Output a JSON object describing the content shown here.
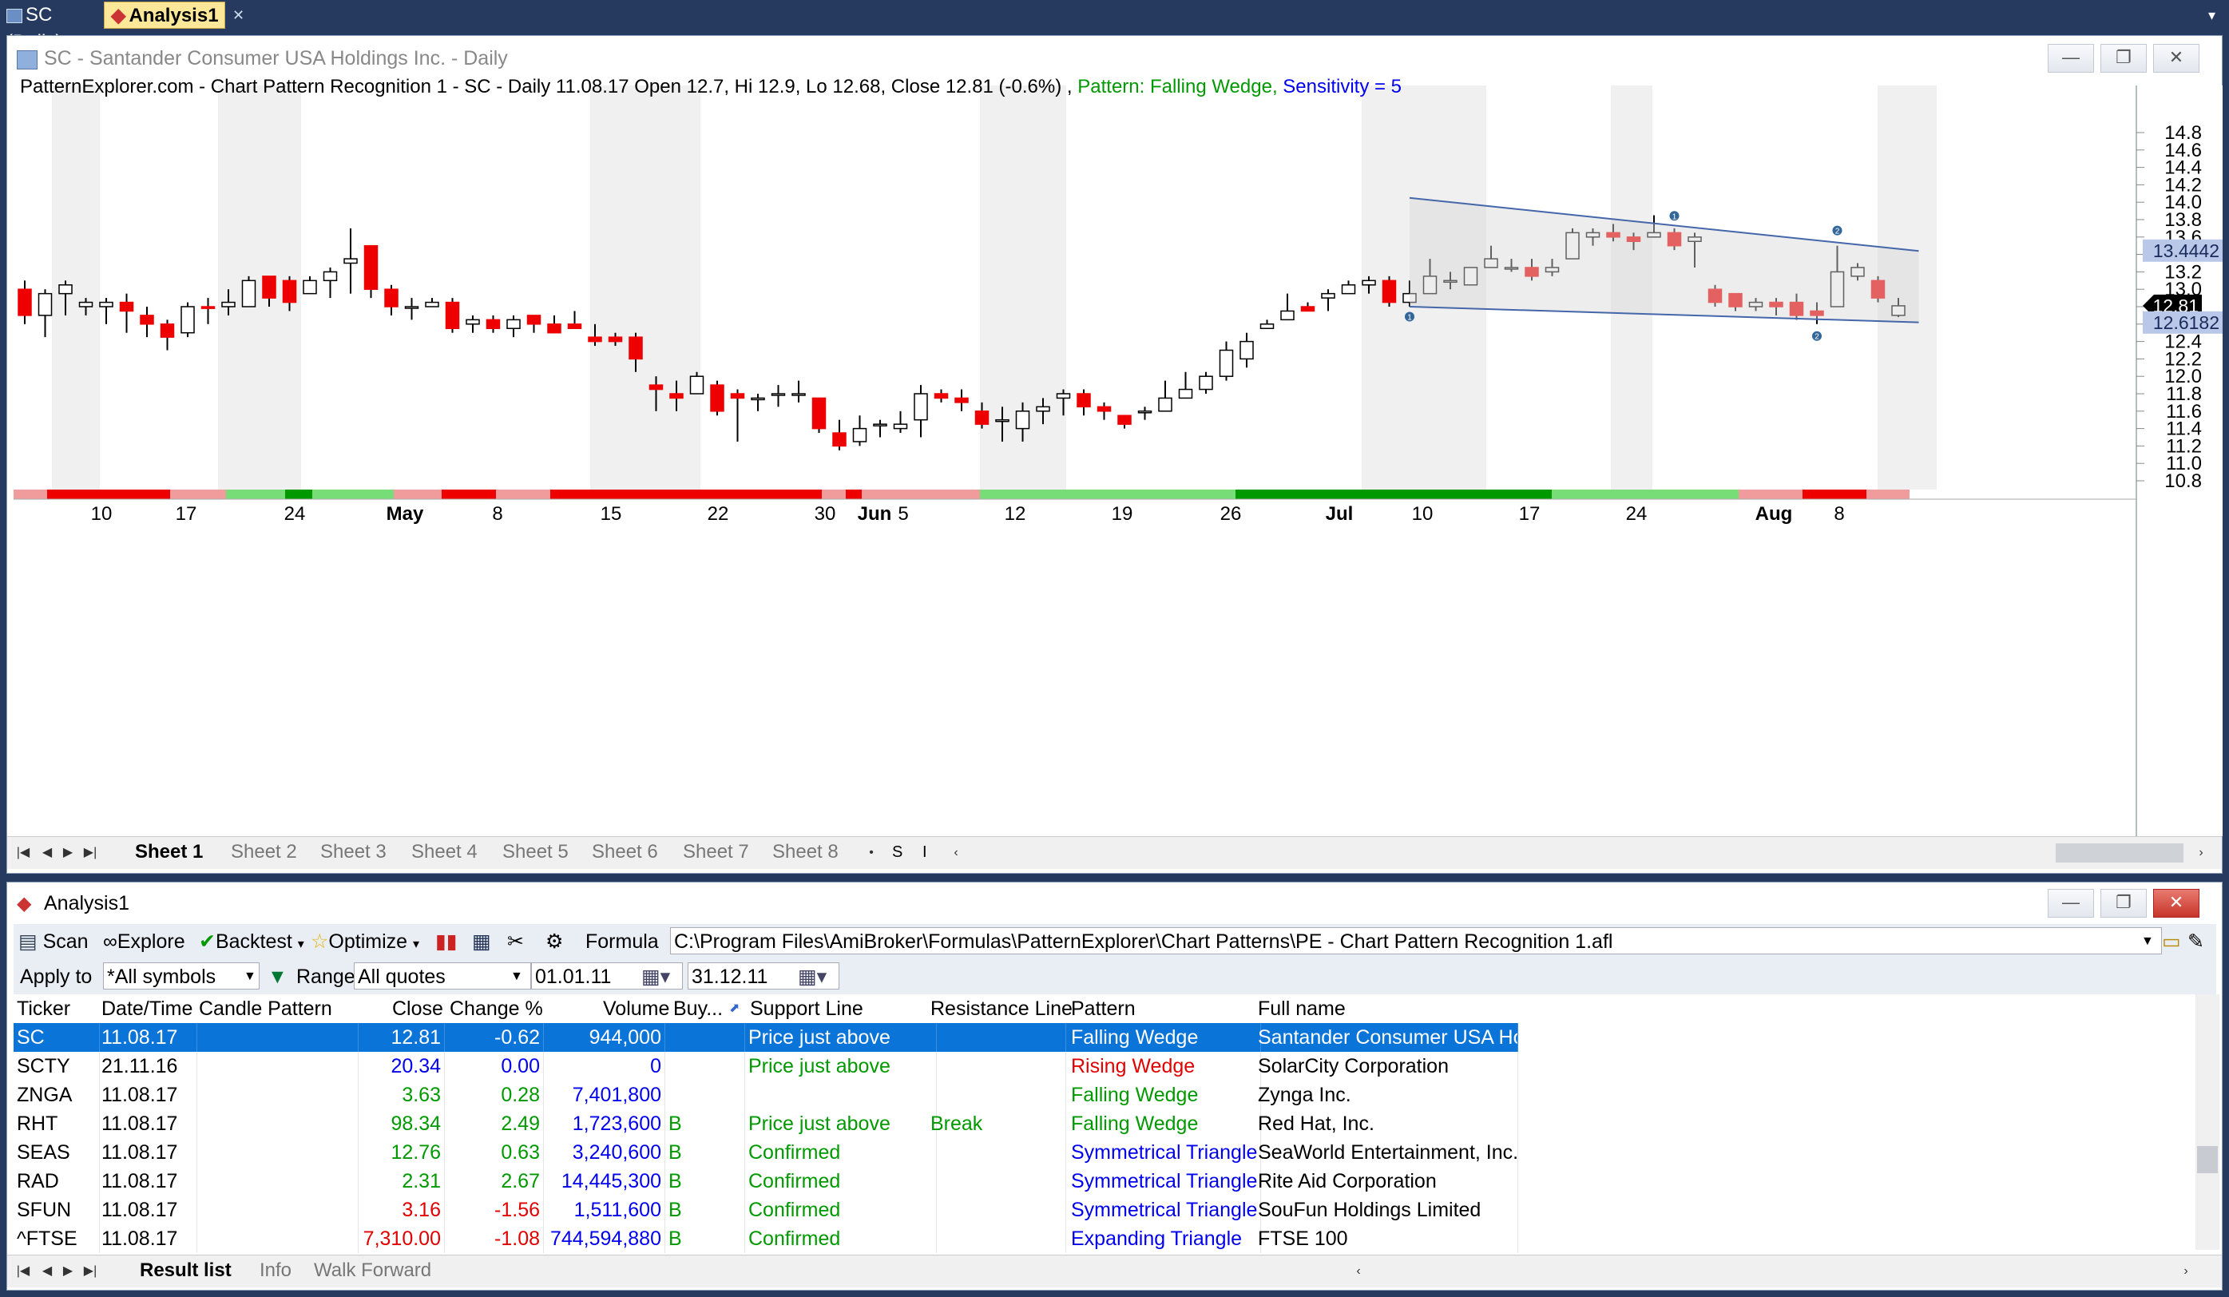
{
  "doc_tabs": [
    {
      "label": "SC (Daily)",
      "active": false
    },
    {
      "label": "Analysis1",
      "active": true
    }
  ],
  "chart_window": {
    "title": "SC - Santander Consumer USA Holdings Inc. - Daily",
    "header_main": "PatternExplorer.com - Chart Pattern Recognition 1 - SC - Daily 11.08.17 Open 12.7, Hi 12.9, Lo 12.68, Close 12.81 (-0.6%) ,",
    "header_pattern": "Pattern: Falling Wedge,",
    "header_sensitivity": "Sensitivity = 5",
    "price_labels": {
      "upper": "13.4442",
      "last": "12.81",
      "lower": "12.6182"
    },
    "pattern_markers": [
      "1",
      "1",
      "2",
      "2"
    ],
    "sheet_tabs": [
      "Sheet 1",
      "Sheet 2",
      "Sheet 3",
      "Sheet 4",
      "Sheet 5",
      "Sheet 6",
      "Sheet 7",
      "Sheet 8"
    ],
    "sheet_extra": [
      "S",
      "I"
    ]
  },
  "chart_data": {
    "type": "candlestick",
    "y_ticks": [
      "14.8",
      "14.6",
      "14.4",
      "14.2",
      "14.0",
      "13.8",
      "13.6",
      "13.4",
      "13.2",
      "13.0",
      "12.8",
      "12.6",
      "12.4",
      "12.2",
      "12.0",
      "11.8",
      "11.6",
      "11.4",
      "11.2",
      "11.0",
      "10.8"
    ],
    "x_ticks": [
      "10",
      "17",
      "24",
      "May",
      "8",
      "15",
      "22",
      "30",
      "Jun",
      "5",
      "12",
      "19",
      "26",
      "Jul",
      "10",
      "17",
      "24",
      "Aug",
      "8"
    ],
    "ylim": [
      10.7,
      14.9
    ],
    "candles": [
      [
        13.0,
        12.7,
        13.1,
        12.6
      ],
      [
        12.7,
        12.95,
        13.0,
        12.45
      ],
      [
        12.95,
        13.05,
        13.1,
        12.7
      ],
      [
        12.8,
        12.85,
        12.9,
        12.7
      ],
      [
        12.8,
        12.85,
        12.9,
        12.6
      ],
      [
        12.85,
        12.75,
        12.95,
        12.5
      ],
      [
        12.7,
        12.6,
        12.8,
        12.45
      ],
      [
        12.6,
        12.45,
        12.65,
        12.3
      ],
      [
        12.5,
        12.8,
        12.85,
        12.45
      ],
      [
        12.8,
        12.78,
        12.9,
        12.6
      ],
      [
        12.8,
        12.85,
        13.0,
        12.7
      ],
      [
        12.8,
        13.1,
        13.15,
        12.8
      ],
      [
        13.15,
        12.9,
        13.15,
        12.8
      ],
      [
        13.1,
        12.85,
        13.15,
        12.75
      ],
      [
        12.95,
        13.1,
        13.15,
        12.95
      ],
      [
        13.1,
        13.2,
        13.25,
        12.9
      ],
      [
        13.3,
        13.35,
        13.7,
        12.95
      ],
      [
        13.5,
        13.0,
        13.5,
        12.9
      ],
      [
        13.0,
        12.8,
        13.05,
        12.7
      ],
      [
        12.8,
        12.8,
        12.9,
        12.65
      ],
      [
        12.8,
        12.85,
        12.9,
        12.8
      ],
      [
        12.85,
        12.55,
        12.9,
        12.5
      ],
      [
        12.6,
        12.65,
        12.7,
        12.5
      ],
      [
        12.65,
        12.55,
        12.7,
        12.5
      ],
      [
        12.55,
        12.65,
        12.7,
        12.45
      ],
      [
        12.7,
        12.6,
        12.7,
        12.5
      ],
      [
        12.6,
        12.5,
        12.7,
        12.5
      ],
      [
        12.6,
        12.55,
        12.75,
        12.55
      ],
      [
        12.45,
        12.4,
        12.6,
        12.35
      ],
      [
        12.45,
        12.4,
        12.5,
        12.35
      ],
      [
        12.45,
        12.2,
        12.5,
        12.05
      ],
      [
        11.9,
        11.85,
        12.0,
        11.6
      ],
      [
        11.8,
        11.75,
        11.95,
        11.6
      ],
      [
        11.8,
        12.0,
        12.05,
        11.8
      ],
      [
        11.9,
        11.6,
        11.95,
        11.55
      ],
      [
        11.8,
        11.75,
        11.85,
        11.25
      ],
      [
        11.75,
        11.75,
        11.8,
        11.6
      ],
      [
        11.8,
        11.8,
        11.9,
        11.65
      ],
      [
        11.8,
        11.8,
        11.95,
        11.7
      ],
      [
        11.75,
        11.4,
        11.75,
        11.35
      ],
      [
        11.35,
        11.2,
        11.5,
        11.15
      ],
      [
        11.25,
        11.4,
        11.55,
        11.2
      ],
      [
        11.45,
        11.45,
        11.5,
        11.3
      ],
      [
        11.4,
        11.45,
        11.6,
        11.35
      ],
      [
        11.5,
        11.8,
        11.9,
        11.3
      ],
      [
        11.8,
        11.75,
        11.85,
        11.7
      ],
      [
        11.75,
        11.7,
        11.85,
        11.6
      ],
      [
        11.6,
        11.45,
        11.7,
        11.4
      ],
      [
        11.5,
        11.5,
        11.65,
        11.25
      ],
      [
        11.4,
        11.6,
        11.7,
        11.25
      ],
      [
        11.6,
        11.65,
        11.75,
        11.45
      ],
      [
        11.75,
        11.8,
        11.85,
        11.55
      ],
      [
        11.8,
        11.65,
        11.85,
        11.55
      ],
      [
        11.65,
        11.6,
        11.7,
        11.5
      ],
      [
        11.55,
        11.45,
        11.55,
        11.4
      ],
      [
        11.6,
        11.6,
        11.65,
        11.5
      ],
      [
        11.6,
        11.75,
        11.95,
        11.6
      ],
      [
        11.75,
        11.85,
        12.05,
        11.75
      ],
      [
        11.85,
        12.0,
        12.05,
        11.8
      ],
      [
        12.0,
        12.3,
        12.4,
        11.95
      ],
      [
        12.2,
        12.4,
        12.5,
        12.1
      ],
      [
        12.55,
        12.6,
        12.65,
        12.55
      ],
      [
        12.65,
        12.75,
        12.95,
        12.65
      ],
      [
        12.8,
        12.75,
        12.85,
        12.75
      ],
      [
        12.9,
        12.95,
        13.0,
        12.75
      ],
      [
        12.95,
        13.05,
        13.1,
        12.95
      ],
      [
        13.05,
        13.1,
        13.15,
        12.95
      ],
      [
        13.1,
        12.85,
        13.15,
        12.8
      ],
      [
        12.85,
        12.95,
        13.1,
        12.8
      ],
      [
        12.95,
        13.15,
        13.35,
        13.0
      ],
      [
        13.1,
        13.1,
        13.2,
        13.0
      ],
      [
        13.05,
        13.25,
        13.25,
        13.05
      ],
      [
        13.25,
        13.35,
        13.5,
        13.25
      ],
      [
        13.25,
        13.25,
        13.35,
        13.2
      ],
      [
        13.25,
        13.15,
        13.35,
        13.1
      ],
      [
        13.2,
        13.25,
        13.35,
        13.15
      ],
      [
        13.35,
        13.65,
        13.7,
        13.35
      ],
      [
        13.6,
        13.65,
        13.7,
        13.5
      ],
      [
        13.65,
        13.6,
        13.75,
        13.55
      ],
      [
        13.6,
        13.55,
        13.65,
        13.45
      ],
      [
        13.6,
        13.65,
        13.85,
        13.6
      ],
      [
        13.65,
        13.5,
        13.7,
        13.45
      ],
      [
        13.55,
        13.6,
        13.65,
        13.25
      ],
      [
        13.0,
        12.85,
        13.05,
        12.8
      ],
      [
        12.95,
        12.8,
        12.95,
        12.75
      ],
      [
        12.8,
        12.85,
        12.9,
        12.75
      ],
      [
        12.85,
        12.8,
        12.9,
        12.7
      ],
      [
        12.85,
        12.7,
        12.95,
        12.65
      ],
      [
        12.75,
        12.7,
        12.85,
        12.6
      ],
      [
        12.8,
        13.2,
        13.5,
        13.0
      ],
      [
        13.15,
        13.25,
        13.3,
        13.1
      ],
      [
        13.1,
        12.9,
        13.15,
        12.85
      ],
      [
        12.7,
        12.81,
        12.9,
        12.68
      ]
    ]
  },
  "analysis_window": {
    "title": "Analysis1",
    "toolbar": {
      "scan": "Scan",
      "explore": "Explore",
      "backtest": "Backtest",
      "optimize": "Optimize",
      "formula_label": "Formula",
      "formula_path": "C:\\Program Files\\AmiBroker\\Formulas\\PatternExplorer\\Chart Patterns\\PE - Chart Pattern Recognition 1.afl"
    },
    "filters": {
      "apply_to_label": "Apply to",
      "apply_to_value": "*All symbols",
      "range_label": "Range",
      "range_value": "All quotes",
      "date_from": "01.01.11",
      "date_to": "31.12.11"
    },
    "columns": [
      "Ticker",
      "Date/Time",
      "Candle Pattern",
      "Close",
      "Change %",
      "Volume",
      "Buy...",
      "Support Line",
      "Resistance Line",
      "Pattern",
      "Full name"
    ],
    "rows": [
      {
        "ticker": "SC",
        "date": "11.08.17",
        "candle": "",
        "close": "12.81",
        "change": "-0.62",
        "volume": "944,000",
        "buy": "",
        "support": "Price just above",
        "resistance": "",
        "pattern": "Falling Wedge",
        "name": "Santander Consumer USA Hol..",
        "close_color": "#ffffff",
        "change_color": "#ffffff",
        "pattern_color": "#ffffff",
        "selected": true
      },
      {
        "ticker": "SCTY",
        "date": "21.11.16",
        "candle": "",
        "close": "20.34",
        "change": "0.00",
        "volume": "0",
        "buy": "",
        "support": "Price just above",
        "resistance": "",
        "pattern": "Rising Wedge",
        "name": "SolarCity Corporation",
        "close_color": "#0000ee",
        "change_color": "#0000ee",
        "pattern_color": "#e00000",
        "selected": false
      },
      {
        "ticker": "ZNGA",
        "date": "11.08.17",
        "candle": "",
        "close": "3.63",
        "change": "0.28",
        "volume": "7,401,800",
        "buy": "",
        "support": "",
        "resistance": "",
        "pattern": "Falling Wedge",
        "name": "Zynga Inc.",
        "close_color": "#009900",
        "change_color": "#009900",
        "pattern_color": "#009900",
        "selected": false
      },
      {
        "ticker": "RHT",
        "date": "11.08.17",
        "candle": "",
        "close": "98.34",
        "change": "2.49",
        "volume": "1,723,600",
        "buy": "B",
        "support": "Price just above",
        "resistance": "Break",
        "pattern": "Falling Wedge",
        "name": "Red Hat, Inc.",
        "close_color": "#009900",
        "change_color": "#009900",
        "pattern_color": "#009900",
        "selected": false
      },
      {
        "ticker": "SEAS",
        "date": "11.08.17",
        "candle": "",
        "close": "12.76",
        "change": "0.63",
        "volume": "3,240,600",
        "buy": "B",
        "support": "Confirmed",
        "resistance": "",
        "pattern": "Symmetrical Triangle",
        "name": "SeaWorld Entertainment, Inc.",
        "close_color": "#009900",
        "change_color": "#009900",
        "pattern_color": "#0000ee",
        "selected": false
      },
      {
        "ticker": "RAD",
        "date": "11.08.17",
        "candle": "",
        "close": "2.31",
        "change": "2.67",
        "volume": "14,445,300",
        "buy": "B",
        "support": "Confirmed",
        "resistance": "",
        "pattern": "Symmetrical Triangle",
        "name": "Rite Aid Corporation",
        "close_color": "#009900",
        "change_color": "#009900",
        "pattern_color": "#0000ee",
        "selected": false
      },
      {
        "ticker": "SFUN",
        "date": "11.08.17",
        "candle": "",
        "close": "3.16",
        "change": "-1.56",
        "volume": "1,511,600",
        "buy": "B",
        "support": "Confirmed",
        "resistance": "",
        "pattern": "Symmetrical Triangle",
        "name": "SouFun Holdings Limited",
        "close_color": "#e00000",
        "change_color": "#e00000",
        "pattern_color": "#0000ee",
        "selected": false
      },
      {
        "ticker": "^FTSE",
        "date": "11.08.17",
        "candle": "",
        "close": "7,310.00",
        "change": "-1.08",
        "volume": "744,594,880",
        "buy": "B",
        "support": "Confirmed",
        "resistance": "",
        "pattern": "Expanding Triangle",
        "name": "FTSE 100",
        "close_color": "#e00000",
        "change_color": "#e00000",
        "pattern_color": "#0000ee",
        "selected": false
      }
    ],
    "bottom_tabs": [
      "Result list",
      "Info",
      "Walk Forward"
    ]
  }
}
